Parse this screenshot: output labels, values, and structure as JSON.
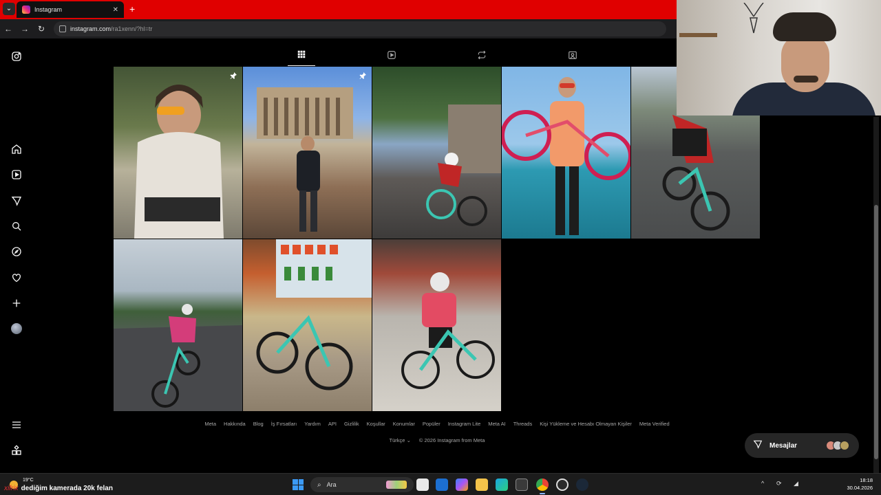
{
  "browser": {
    "tab_title": "Instagram",
    "url_host": "instagram.com",
    "url_path": "/ra1xenn/?hl=tr"
  },
  "sidebar": {
    "items": [
      "instagram-logo",
      "home",
      "reels",
      "messages",
      "search",
      "explore",
      "notifications",
      "create",
      "profile",
      "more",
      "also-from-meta"
    ]
  },
  "profile_tabs": [
    "posts",
    "reels",
    "reposts",
    "tagged"
  ],
  "posts": [
    {
      "pinned": true
    },
    {
      "pinned": true
    },
    {
      "pinned": false
    },
    {
      "pinned": false
    },
    {
      "pinned": false
    },
    {
      "pinned": false
    },
    {
      "pinned": false
    },
    {
      "pinned": false
    }
  ],
  "footer": {
    "links": [
      "Meta",
      "Hakkında",
      "Blog",
      "İş Fırsatları",
      "Yardım",
      "API",
      "Gizlilik",
      "Koşullar",
      "Konumlar",
      "Popüler",
      "Instagram Lite",
      "Meta AI",
      "Threads",
      "Kişi Yükleme ve Hesabı Olmayan Kişiler",
      "Meta Verified"
    ],
    "language": "Türkçe",
    "copyright": "© 2026 Instagram from Meta"
  },
  "messages_button": {
    "label": "Mesajlar"
  },
  "taskbar": {
    "temperature": "19°C",
    "caption": "dediğim kamerada 20k felan",
    "search_label": "Ara",
    "time": "18:18",
    "date": "30.04.2026"
  },
  "colors": {
    "tabbar": "#e00000",
    "background": "#000000",
    "accent": "#0095f6"
  }
}
